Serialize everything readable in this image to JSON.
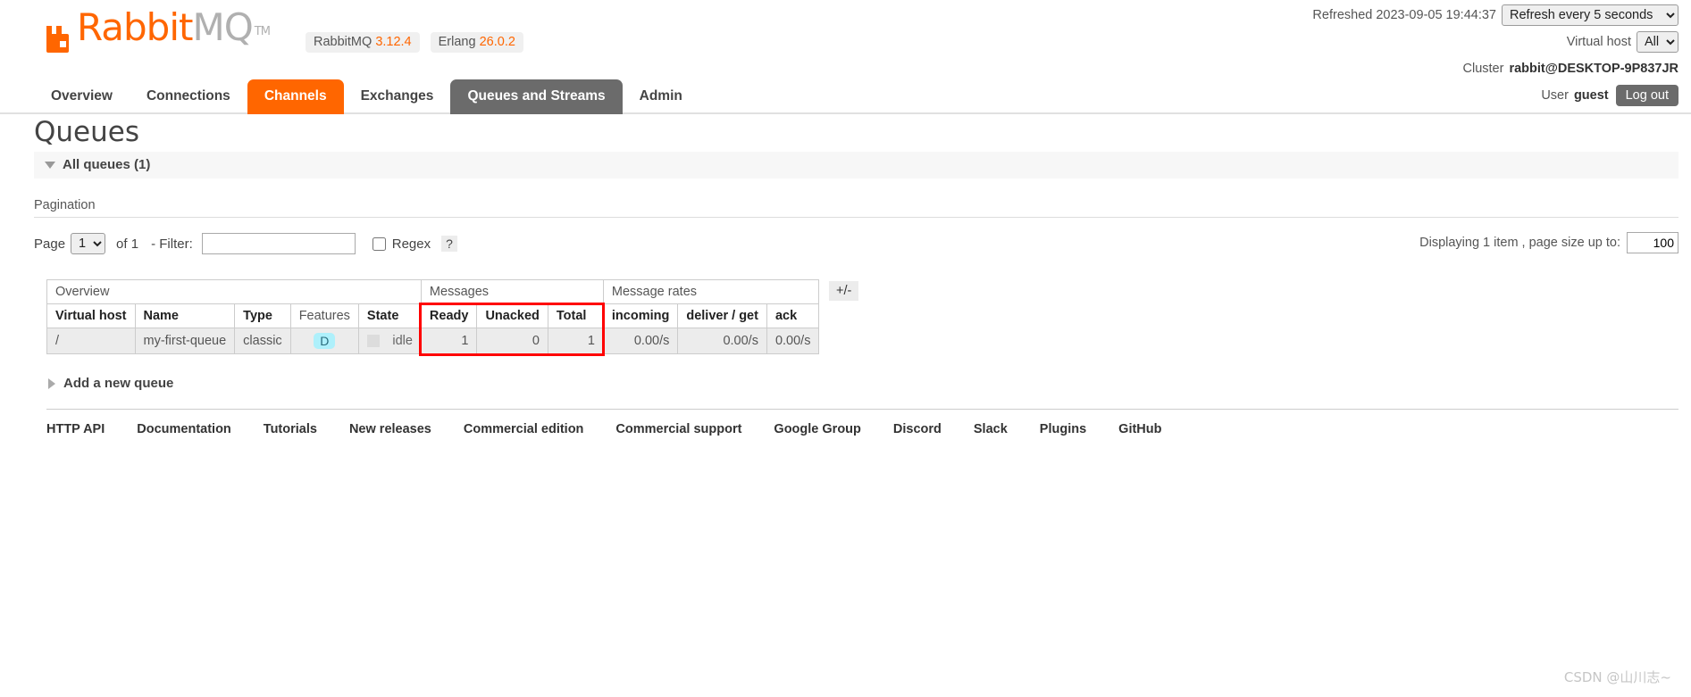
{
  "header": {
    "logo_rabbit": "Rabbit",
    "logo_mq": "MQ",
    "logo_tm": "TM",
    "versions": [
      {
        "name": "RabbitMQ",
        "number": "3.12.4"
      },
      {
        "name": "Erlang",
        "number": "26.0.2"
      }
    ],
    "refreshed_label": "Refreshed 2023-09-05 19:44:37",
    "refresh_select_value": "Refresh every 5 seconds",
    "refresh_options": [
      "Refresh every 5 seconds"
    ],
    "vhost_label": "Virtual host",
    "vhost_value": "All",
    "vhost_options": [
      "All"
    ],
    "cluster_label": "Cluster",
    "cluster_name": "rabbit@DESKTOP-9P837JR",
    "user_label": "User",
    "user_name": "guest",
    "logout_label": "Log out"
  },
  "nav": {
    "tabs": [
      {
        "label": "Overview",
        "state": "normal"
      },
      {
        "label": "Connections",
        "state": "normal"
      },
      {
        "label": "Channels",
        "state": "active-orange"
      },
      {
        "label": "Exchanges",
        "state": "normal"
      },
      {
        "label": "Queues and Streams",
        "state": "active-grey"
      },
      {
        "label": "Admin",
        "state": "normal"
      }
    ]
  },
  "page": {
    "title": "Queues",
    "section_label": "All queues (1)",
    "pagination_label": "Pagination",
    "page_label": "Page",
    "page_value": "1",
    "page_options": [
      "1"
    ],
    "of_label": "of 1",
    "filter_label": "- Filter:",
    "filter_value": "",
    "regex_label": "Regex",
    "regex_help": "?",
    "regex_checked": false,
    "displaying_label": "Displaying 1 item , page size up to:",
    "page_size_value": "100",
    "plus_minus_label": "+/-",
    "add_queue_label": "Add a new queue"
  },
  "table": {
    "group_headers": [
      {
        "label": "Overview",
        "colspan": 5
      },
      {
        "label": "Messages",
        "colspan": 3
      },
      {
        "label": "Message rates",
        "colspan": 3
      }
    ],
    "columns": [
      {
        "label": "Virtual host",
        "bold": true,
        "align": "left"
      },
      {
        "label": "Name",
        "bold": true,
        "align": "left"
      },
      {
        "label": "Type",
        "bold": true,
        "align": "left"
      },
      {
        "label": "Features",
        "bold": false,
        "align": "center"
      },
      {
        "label": "State",
        "bold": true,
        "align": "left"
      },
      {
        "label": "Ready",
        "bold": true,
        "align": "left"
      },
      {
        "label": "Unacked",
        "bold": true,
        "align": "left"
      },
      {
        "label": "Total",
        "bold": true,
        "align": "left"
      },
      {
        "label": "incoming",
        "bold": true,
        "align": "left"
      },
      {
        "label": "deliver / get",
        "bold": true,
        "align": "left"
      },
      {
        "label": "ack",
        "bold": true,
        "align": "left"
      }
    ],
    "rows": [
      {
        "vhost": "/",
        "name": "my-first-queue",
        "type": "classic",
        "features": "D",
        "state": "idle",
        "ready": "1",
        "unacked": "0",
        "total": "1",
        "incoming": "0.00/s",
        "deliver_get": "0.00/s",
        "ack": "0.00/s"
      }
    ]
  },
  "footer": {
    "links": [
      "HTTP API",
      "Documentation",
      "Tutorials",
      "New releases",
      "Commercial edition",
      "Commercial support",
      "Google Group",
      "Discord",
      "Slack",
      "Plugins",
      "GitHub"
    ]
  },
  "watermark": "CSDN @山川志~",
  "colors": {
    "accent": "#ff6600",
    "tab_active_grey": "#6b6b6b",
    "highlight_red": "#ff0000",
    "badge_cyan": "#aef0fb"
  }
}
